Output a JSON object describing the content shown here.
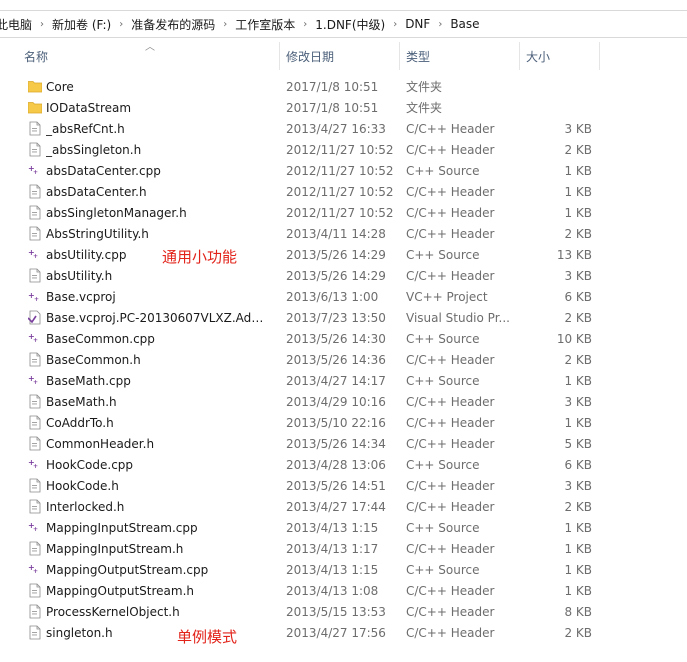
{
  "breadcrumb": [
    "此电脑",
    "新加卷 (F:)",
    "准备发布的源码",
    "工作室版本",
    "1.DNF(中级)",
    "DNF",
    "Base"
  ],
  "columns": {
    "name": "名称",
    "date": "修改日期",
    "type": "类型",
    "size": "大小"
  },
  "files": [
    {
      "name": "Core",
      "date": "2017/1/8 10:51",
      "type": "文件夹",
      "size": "",
      "icon": "folder-icon"
    },
    {
      "name": "IODataStream",
      "date": "2017/1/8 10:51",
      "type": "文件夹",
      "size": "",
      "icon": "folder-icon"
    },
    {
      "name": "_absRefCnt.h",
      "date": "2013/4/27 16:33",
      "type": "C/C++ Header",
      "size": "3 KB",
      "icon": "header-file-icon"
    },
    {
      "name": "_absSingleton.h",
      "date": "2012/11/27 10:52",
      "type": "C/C++ Header",
      "size": "2 KB",
      "icon": "header-file-icon"
    },
    {
      "name": "absDataCenter.cpp",
      "date": "2012/11/27 10:52",
      "type": "C++ Source",
      "size": "1 KB",
      "icon": "cpp-file-icon"
    },
    {
      "name": "absDataCenter.h",
      "date": "2012/11/27 10:52",
      "type": "C/C++ Header",
      "size": "1 KB",
      "icon": "header-file-icon"
    },
    {
      "name": "absSingletonManager.h",
      "date": "2012/11/27 10:52",
      "type": "C/C++ Header",
      "size": "1 KB",
      "icon": "header-file-icon"
    },
    {
      "name": "AbsStringUtility.h",
      "date": "2013/4/11 14:28",
      "type": "C/C++ Header",
      "size": "2 KB",
      "icon": "header-file-icon"
    },
    {
      "name": "absUtility.cpp",
      "date": "2013/5/26 14:29",
      "type": "C++ Source",
      "size": "13 KB",
      "icon": "cpp-file-icon"
    },
    {
      "name": "absUtility.h",
      "date": "2013/5/26 14:29",
      "type": "C/C++ Header",
      "size": "3 KB",
      "icon": "header-file-icon"
    },
    {
      "name": "Base.vcproj",
      "date": "2013/6/13 1:00",
      "type": "VC++ Project",
      "size": "6 KB",
      "icon": "vcproj-file-icon"
    },
    {
      "name": "Base.vcproj.PC-20130607VLXZ.Admin...",
      "date": "2013/7/23 13:50",
      "type": "Visual Studio Pr...",
      "size": "2 KB",
      "icon": "vs-user-file-icon"
    },
    {
      "name": "BaseCommon.cpp",
      "date": "2013/5/26 14:30",
      "type": "C++ Source",
      "size": "10 KB",
      "icon": "cpp-file-icon"
    },
    {
      "name": "BaseCommon.h",
      "date": "2013/5/26 14:36",
      "type": "C/C++ Header",
      "size": "2 KB",
      "icon": "header-file-icon"
    },
    {
      "name": "BaseMath.cpp",
      "date": "2013/4/27 14:17",
      "type": "C++ Source",
      "size": "1 KB",
      "icon": "cpp-file-icon"
    },
    {
      "name": "BaseMath.h",
      "date": "2013/4/29 10:16",
      "type": "C/C++ Header",
      "size": "3 KB",
      "icon": "header-file-icon"
    },
    {
      "name": "CoAddrTo.h",
      "date": "2013/5/10 22:16",
      "type": "C/C++ Header",
      "size": "1 KB",
      "icon": "header-file-icon"
    },
    {
      "name": "CommonHeader.h",
      "date": "2013/5/26 14:34",
      "type": "C/C++ Header",
      "size": "5 KB",
      "icon": "header-file-icon"
    },
    {
      "name": "HookCode.cpp",
      "date": "2013/4/28 13:06",
      "type": "C++ Source",
      "size": "6 KB",
      "icon": "cpp-file-icon"
    },
    {
      "name": "HookCode.h",
      "date": "2013/5/26 14:51",
      "type": "C/C++ Header",
      "size": "3 KB",
      "icon": "header-file-icon"
    },
    {
      "name": "Interlocked.h",
      "date": "2013/4/27 17:44",
      "type": "C/C++ Header",
      "size": "2 KB",
      "icon": "header-file-icon"
    },
    {
      "name": "MappingInputStream.cpp",
      "date": "2013/4/13 1:15",
      "type": "C++ Source",
      "size": "1 KB",
      "icon": "cpp-file-icon"
    },
    {
      "name": "MappingInputStream.h",
      "date": "2013/4/13 1:17",
      "type": "C/C++ Header",
      "size": "1 KB",
      "icon": "header-file-icon"
    },
    {
      "name": "MappingOutputStream.cpp",
      "date": "2013/4/13 1:15",
      "type": "C++ Source",
      "size": "1 KB",
      "icon": "cpp-file-icon"
    },
    {
      "name": "MappingOutputStream.h",
      "date": "2013/4/13 1:08",
      "type": "C/C++ Header",
      "size": "1 KB",
      "icon": "header-file-icon"
    },
    {
      "name": "ProcessKernelObject.h",
      "date": "2013/5/15 13:53",
      "type": "C/C++ Header",
      "size": "8 KB",
      "icon": "header-file-icon"
    },
    {
      "name": "singleton.h",
      "date": "2013/4/27 17:56",
      "type": "C/C++ Header",
      "size": "2 KB",
      "icon": "header-file-icon"
    }
  ],
  "annotations": [
    "通用小功能",
    "单例模式"
  ],
  "colors": {
    "annotation": "#e2231a",
    "folder": "#f7c948",
    "cpp_accent": "#7a3e9d",
    "header_text": "#4c607a"
  }
}
